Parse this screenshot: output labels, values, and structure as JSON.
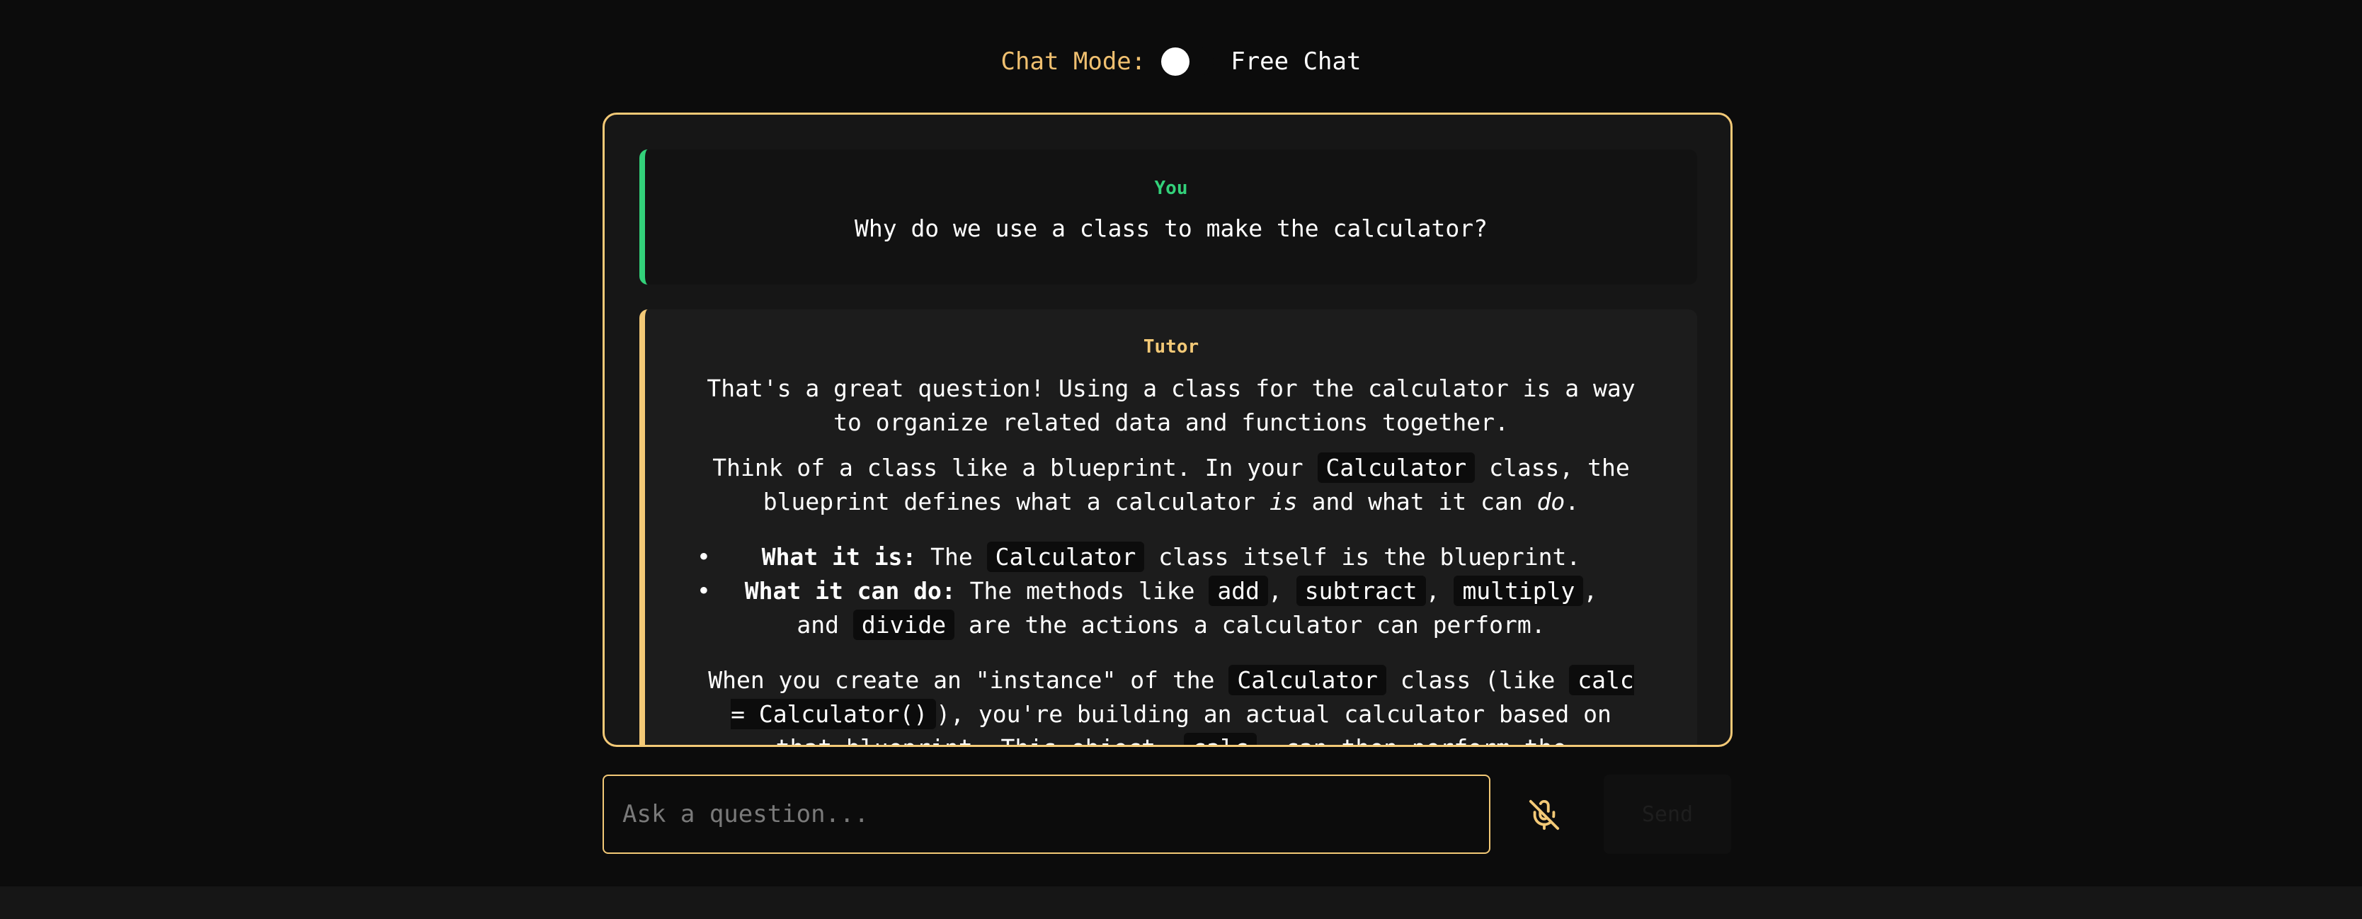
{
  "chat_mode": {
    "label": "Chat Mode:",
    "value": "Free Chat"
  },
  "messages": {
    "user": {
      "sender": "You",
      "text": "Why do we use a class to make the calculator?"
    },
    "tutor": {
      "sender": "Tutor",
      "p1": "That's a great question! Using a class for the calculator is a way to organize related data and functions together.",
      "p2_a": "Think of a class like a blueprint. In your ",
      "p2_code": "Calculator",
      "p2_b": " class, the blueprint defines what a calculator ",
      "p2_em1": "is",
      "p2_c": " and what it can ",
      "p2_em2": "do",
      "p2_d": ".",
      "b1_strong": "What it is:",
      "b1_a": " The ",
      "b1_code": "Calculator",
      "b1_b": " class itself is the blueprint.",
      "b2_strong": "What it can do:",
      "b2_a": " The methods like ",
      "b2_code1": "add",
      "b2_sep1": ", ",
      "b2_code2": "subtract",
      "b2_sep2": ", ",
      "b2_code3": "multiply",
      "b2_sep3": ", and ",
      "b2_code4": "divide",
      "b2_b": " are the actions a calculator can perform.",
      "p3_a": "When you create an \"instance\" of the ",
      "p3_code1": "Calculator",
      "p3_b": " class (like ",
      "p3_code2": "calc = Calculator()",
      "p3_c": "), you're building an actual calculator based on that blueprint. This object, ",
      "p3_code3": "calc",
      "p3_d": ", can then perform the operations."
    }
  },
  "input": {
    "placeholder": "Ask a question..."
  },
  "send_button": {
    "label": "Send"
  },
  "icons": {
    "mic": "microphone-off-icon"
  },
  "colors": {
    "accent": "#f3c977",
    "user": "#33d17a",
    "background": "#0c0c0c"
  }
}
